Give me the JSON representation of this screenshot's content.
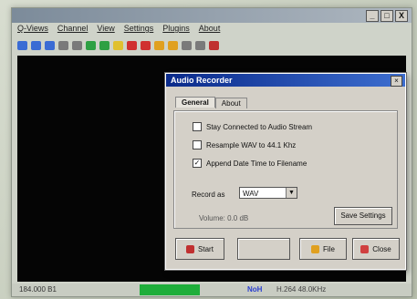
{
  "app": {
    "title": "",
    "window_buttons": [
      "_",
      "□",
      "X"
    ],
    "menu": [
      "Q-Views",
      "Channel",
      "View",
      "Settings",
      "Plugins",
      "About"
    ],
    "toolbar_colors": [
      "#3a6bd4",
      "#3a6bd4",
      "#3a6bd4",
      "#7a7a7a",
      "#7a7a7a",
      "#2ea043",
      "#2ea043",
      "#e0c030",
      "#d03030",
      "#d03030",
      "#e0a020",
      "#e0a020",
      "#7a7a7a",
      "#7a7a7a",
      "#c03030"
    ],
    "status": {
      "left": "184.000  B1",
      "highlight": "",
      "mid": "",
      "hot": "NoH",
      "right": "H.264   48.0KHz"
    }
  },
  "dialog": {
    "title": "Audio Recorder",
    "close": "×",
    "tabs": [
      "General",
      "About"
    ],
    "options": [
      {
        "label": "Stay Connected to Audio Stream",
        "checked": false
      },
      {
        "label": "Resample WAV to 44.1 Khz",
        "checked": false
      },
      {
        "label": "Append Date Time to Filename",
        "checked": true
      }
    ],
    "record_as_label": "Record as",
    "record_as_value": "WAV",
    "volume_label": "Volume: 0.0 dB",
    "save_settings": "Save Settings",
    "buttons": {
      "start": "Start",
      "stop": "",
      "file": "File",
      "close": "Close"
    }
  }
}
